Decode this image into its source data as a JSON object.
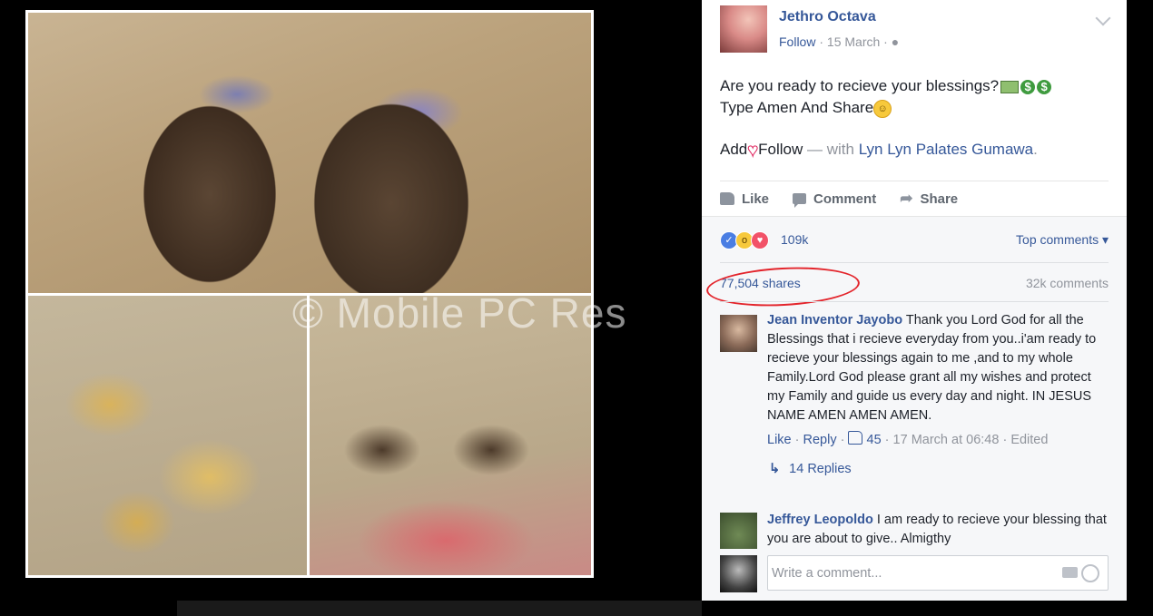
{
  "watermark": "© Mobile PC Res",
  "post": {
    "author": "Jethro Octava",
    "follow_label": "Follow",
    "date": "15 March",
    "separator": "·",
    "text_line1": "Are you ready to recieve your blessings?",
    "text_line2": "Type Amen And Share",
    "text_line3_prefix": "Add",
    "text_line3_suffix": "Follow",
    "with_text": "— with",
    "tagged": "Lyn Lyn Palates Gumawa",
    "period": "."
  },
  "actions": {
    "like": "Like",
    "comment": "Comment",
    "share": "Share"
  },
  "feedback": {
    "reaction_count": "109k",
    "top_comments": "Top comments ▾",
    "shares": "77,504 shares",
    "comments_count": "32k comments"
  },
  "comments": [
    {
      "author": "Jean Inventor Jayobo",
      "text": "Thank you Lord God for all the Blessings that i recieve everyday from you..i'am ready to recieve your blessings again to me ,and to my whole Family.Lord God please grant all my wishes and protect my Family and guide us every day and night. IN JESUS NAME AMEN AMEN AMEN.",
      "like": "Like",
      "reply": "Reply",
      "likes": "45",
      "time": "17 March at 06:48",
      "edited": "Edited",
      "replies": "14 Replies"
    },
    {
      "author": "Jeffrey Leopoldo",
      "text": "I am ready to recieve your blessing that you are about to give.. Almigthy"
    }
  ],
  "write_comment": {
    "placeholder": "Write a comment..."
  },
  "colors": {
    "link": "#365899",
    "muted": "#90949c",
    "annotation": "#e3242b"
  }
}
